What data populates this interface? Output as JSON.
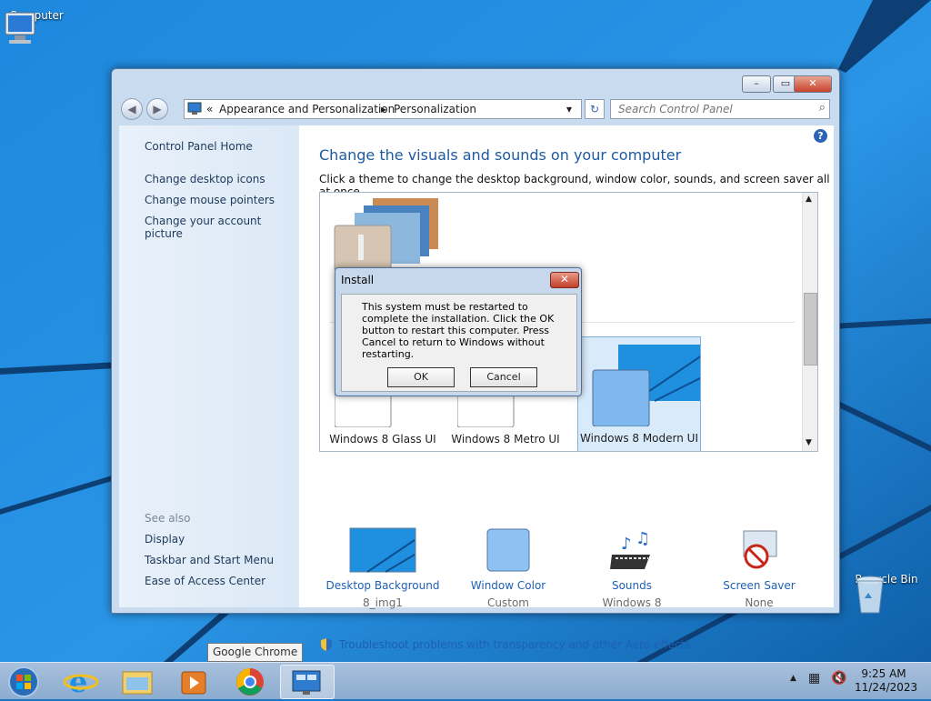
{
  "desktop": {
    "computer_label": "Computer",
    "recycle_label": "Recycle Bin"
  },
  "window": {
    "minimize": "–",
    "maximize": "▭",
    "close": "✕",
    "back": "◀",
    "forward": "▶",
    "breadcrumb_prefix": "«",
    "breadcrumb_1": "Appearance and Personalization",
    "breadcrumb_sep": "▸",
    "breadcrumb_2": "Personalization",
    "address_dropdown": "▾",
    "refresh": "↻",
    "search_placeholder": "Search Control Panel"
  },
  "left_pane": {
    "home": "Control Panel Home",
    "links": [
      "Change desktop icons",
      "Change mouse pointers",
      "Change your account picture"
    ],
    "see_also_title": "See also",
    "see_also": [
      "Display",
      "Taskbar and Start Menu",
      "Ease of Access Center"
    ]
  },
  "main": {
    "heading": "Change the visuals and sounds on your computer",
    "subtitle": "Click a theme to change the desktop background, window color, sounds, and screen saver all at once.",
    "help": "?",
    "themes": [
      "Windows 8 Glass UI",
      "Windows 8 Metro UI",
      "Windows 8 Modern UI"
    ],
    "selected_theme": "Windows 8 Modern UI",
    "bottom": [
      {
        "name": "Desktop Background",
        "value": "8_img1"
      },
      {
        "name": "Window Color",
        "value": "Custom"
      },
      {
        "name": "Sounds",
        "value": "Windows 8"
      },
      {
        "name": "Screen Saver",
        "value": "None"
      }
    ],
    "troubleshoot": "Troubleshoot problems with transparency and other Aero effects"
  },
  "dialog": {
    "title": "Install",
    "message": "This system must be restarted to complete the installation. Click the OK button to restart this computer. Press Cancel to return to Windows without restarting.",
    "ok": "OK",
    "cancel": "Cancel",
    "close": "✕"
  },
  "taskbar": {
    "tooltip": "Google Chrome",
    "time": "9:25 AM",
    "date": "11/24/2023"
  },
  "colors": {
    "desktop_blue": "#1b78c9",
    "link_blue": "#1e60b5",
    "heading_blue": "#1e5aa2"
  },
  "icons": [
    "computer-icon",
    "recycle-bin-icon",
    "start-orb-icon",
    "ie-icon",
    "explorer-icon",
    "media-player-icon",
    "chrome-icon",
    "control-panel-icon",
    "shield-icon",
    "sounds-icon",
    "screen-saver-icon"
  ]
}
